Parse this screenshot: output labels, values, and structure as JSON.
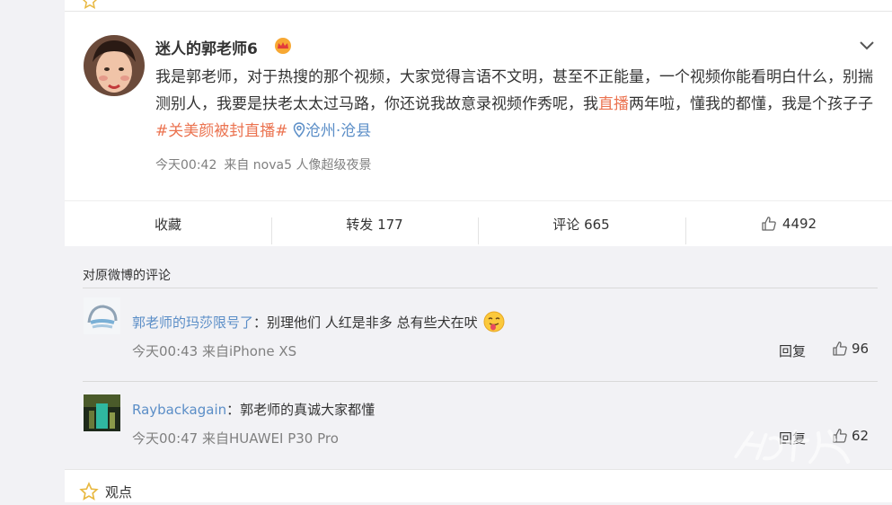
{
  "post": {
    "username": "迷人的郭老师6",
    "text_before_link": "我是郭老师，对于热搜的那个视频，大家觉得言语不文明，甚至不正能量，一个视频你能看明白什么，别揣测别人，我要是扶老太太过马路，你还说我故意录视频作秀呢，我",
    "link_live": "直播",
    "text_after_link": "两年啦，懂我的都懂，我是个孩子子",
    "hashtag": "#关美颜被封直播#",
    "location": "沧州·沧县",
    "time": "今天00:42",
    "source": "来自 nova5 人像超级夜景"
  },
  "actions": {
    "favorite": "收藏",
    "repost": "转发 177",
    "comment": "评论 665",
    "like_count": "4492"
  },
  "comments": {
    "title": "对原微博的评论",
    "items": [
      {
        "username": "郭老师的玛莎限号了",
        "separator": "：",
        "text": "别理他们 人红是非多 总有些犬在吠",
        "meta": "今天00:43 来自iPhone XS",
        "reply": "回复",
        "likes": "96"
      },
      {
        "username": "Raybackagain",
        "separator": "：",
        "text": "郭老师的真诚大家都懂",
        "meta": "今天00:47 来自HUAWEI P30 Pro",
        "reply": "回复",
        "likes": "62"
      }
    ]
  },
  "footer": {
    "label": "观点"
  },
  "icons": {
    "crown": "crown-icon",
    "chevron": "chevron-down-icon",
    "location": "location-pin-icon",
    "like": "thumbs-up-icon",
    "emoji": "tongue-emoji-icon",
    "star": "star-icon"
  },
  "colors": {
    "link": "#eb7350",
    "blue": "#5b8ec7",
    "meta": "#808080",
    "background": "#f2f2f5"
  }
}
